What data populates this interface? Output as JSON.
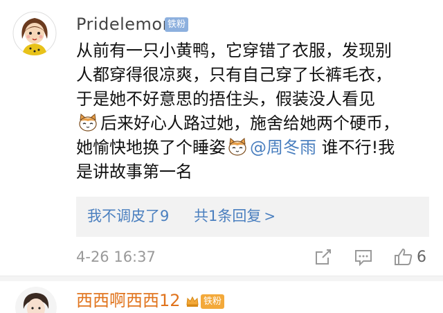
{
  "comment": {
    "username": "Pridelemon",
    "fan_badge": "铁粉",
    "lines": {
      "l1": "从前有一只小黄鸭，它穿错了衣服，发现别",
      "l2": "人都穿得很凉爽，只有自己穿了长裤毛衣，",
      "l3": "于是她不好意思的捂住头，假装没人看见",
      "l4": "后来好心人路过她，施舍给她两个硬币，",
      "l5a": "她愉快地换了个睡姿",
      "mention": "@周冬雨",
      "l5b": " 谁不行!我",
      "l6": "是讲故事第一名"
    },
    "emoji": "cat-emoji",
    "replies": {
      "reply_link": "我不调皮了9",
      "reply_count": "共1条回复",
      "chevron": ">"
    },
    "timestamp": "4-26 16:37",
    "like_count": "6"
  },
  "next_comment": {
    "username": "西西啊西西12",
    "fan_badge": "铁粉"
  },
  "colors": {
    "link": "#4a7fbf",
    "badge_blue": "#8db0de",
    "username_orange": "#e0731c",
    "badge_orange": "#f3a93a",
    "meta_gray": "#999999"
  },
  "icons": [
    "share-icon",
    "comment-icon",
    "like-icon",
    "cat-emoji",
    "crown-icon"
  ]
}
